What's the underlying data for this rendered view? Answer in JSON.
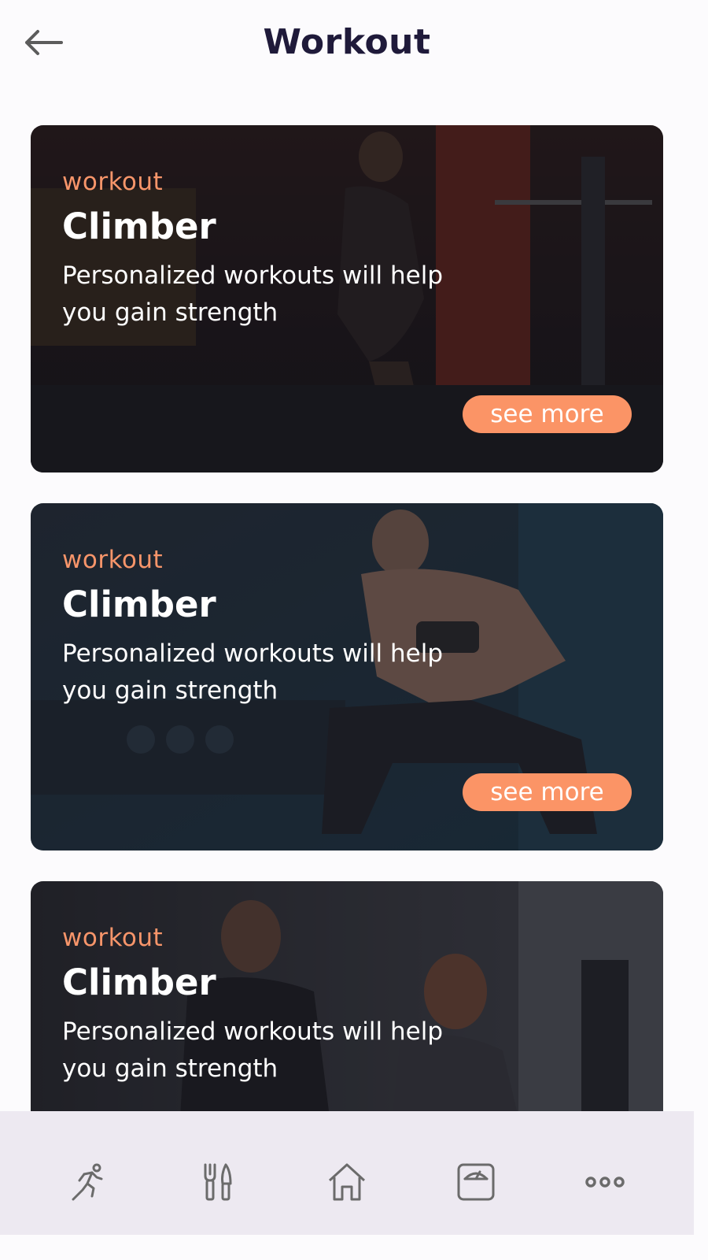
{
  "header": {
    "title": "Workout",
    "back_icon": "arrow-left-icon"
  },
  "cards": [
    {
      "kicker": "workout",
      "title": "Climber",
      "description": "Personalized workouts will help you gain strength",
      "button_label": "see more",
      "image": "woman doing squat in gym"
    },
    {
      "kicker": "workout",
      "title": "Climber",
      "description": "Personalized workouts will help you gain strength",
      "button_label": "see more",
      "image": "man doing dumbbell curl on bench"
    },
    {
      "kicker": "workout",
      "title": "Climber",
      "description": "Personalized workouts will help you gain strength",
      "image": "two people on exercise bikes"
    }
  ],
  "nav": {
    "items": [
      {
        "icon": "running-icon"
      },
      {
        "icon": "fork-knife-icon"
      },
      {
        "icon": "home-icon"
      },
      {
        "icon": "scale-icon"
      },
      {
        "icon": "more-dots-icon"
      }
    ]
  },
  "colors": {
    "accent": "#fb9466",
    "kicker": "#f7956a",
    "title": "#1f1a3a",
    "nav_bg": "#ede9f1",
    "icon": "#6b6b6b"
  }
}
